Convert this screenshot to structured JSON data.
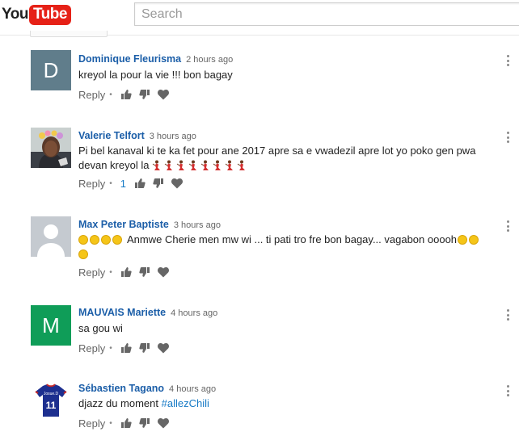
{
  "header": {
    "logo_you": "You",
    "logo_tube": "Tube",
    "search_placeholder": "Search"
  },
  "colors": {
    "brand_red": "#e62117",
    "author_blue": "#1b5ea8",
    "link_blue": "#167ac6",
    "avatar_grey": "#607d8b",
    "avatar_green": "#0f9d58"
  },
  "comments": [
    {
      "author": "Dominique Fleurisma",
      "time": "2 hours ago",
      "avatar_letter": "D",
      "avatar_color": "#607d8b",
      "text": "kreyol la pour la vie !!! bon bagay",
      "reply_label": "Reply",
      "like_count": ""
    },
    {
      "author": "Valerie Telfort",
      "time": "3 hours ago",
      "avatar_kind": "photo",
      "text_line1": "Pi bel kanaval ki te ka fet pour ane 2017 apre sa e vwadezil apre lot yo poko gen pwa",
      "text_line2": "devan kreyol la",
      "emoji_count": 8,
      "emoji_name": "dancer-emoji",
      "reply_label": "Reply",
      "like_count": "1"
    },
    {
      "author": "Max Peter Baptiste",
      "time": "3 hours ago",
      "avatar_kind": "default-person",
      "text": "Anmwe Cherie men mw wi ... ti pati tro fre bon bagay... vagabon ooooh",
      "reply_label": "Reply",
      "like_count": ""
    },
    {
      "author": "MAUVAIS Mariette",
      "time": "4 hours ago",
      "avatar_letter": "M",
      "avatar_color": "#0f9d58",
      "text": "sa gou wi",
      "reply_label": "Reply",
      "like_count": ""
    },
    {
      "author": "Sébastien Tagano",
      "time": "4 hours ago",
      "avatar_kind": "jersey",
      "jersey_text": "Josue.D",
      "jersey_number": "11",
      "text": "djazz du moment",
      "hashtag": "#allezChili",
      "reply_label": "Reply",
      "like_count": ""
    }
  ]
}
